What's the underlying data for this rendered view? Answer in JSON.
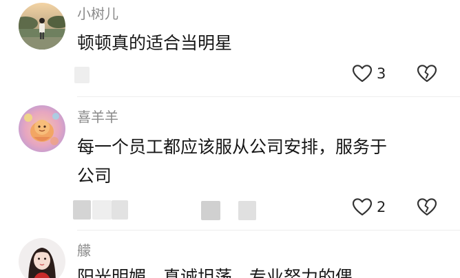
{
  "comments": [
    {
      "username": "小树儿",
      "text_lines": [
        "顿顿真的适合当明星"
      ],
      "likes": "3"
    },
    {
      "username": "喜羊羊",
      "text_lines": [
        "每一个员工都应该服从公司安排，服务于",
        "公司"
      ],
      "likes": "2"
    },
    {
      "username": "艨",
      "text_lines": [
        "阳光明媚，真诚坦荡，专业努力的偶"
      ]
    }
  ],
  "icons": {
    "like": "heart-outline-icon",
    "dislike": "broken-heart-icon"
  },
  "colors": {
    "text": "#161616",
    "username": "#8a8a8a",
    "icon": "#333333",
    "blur": "#d6d6d6"
  }
}
